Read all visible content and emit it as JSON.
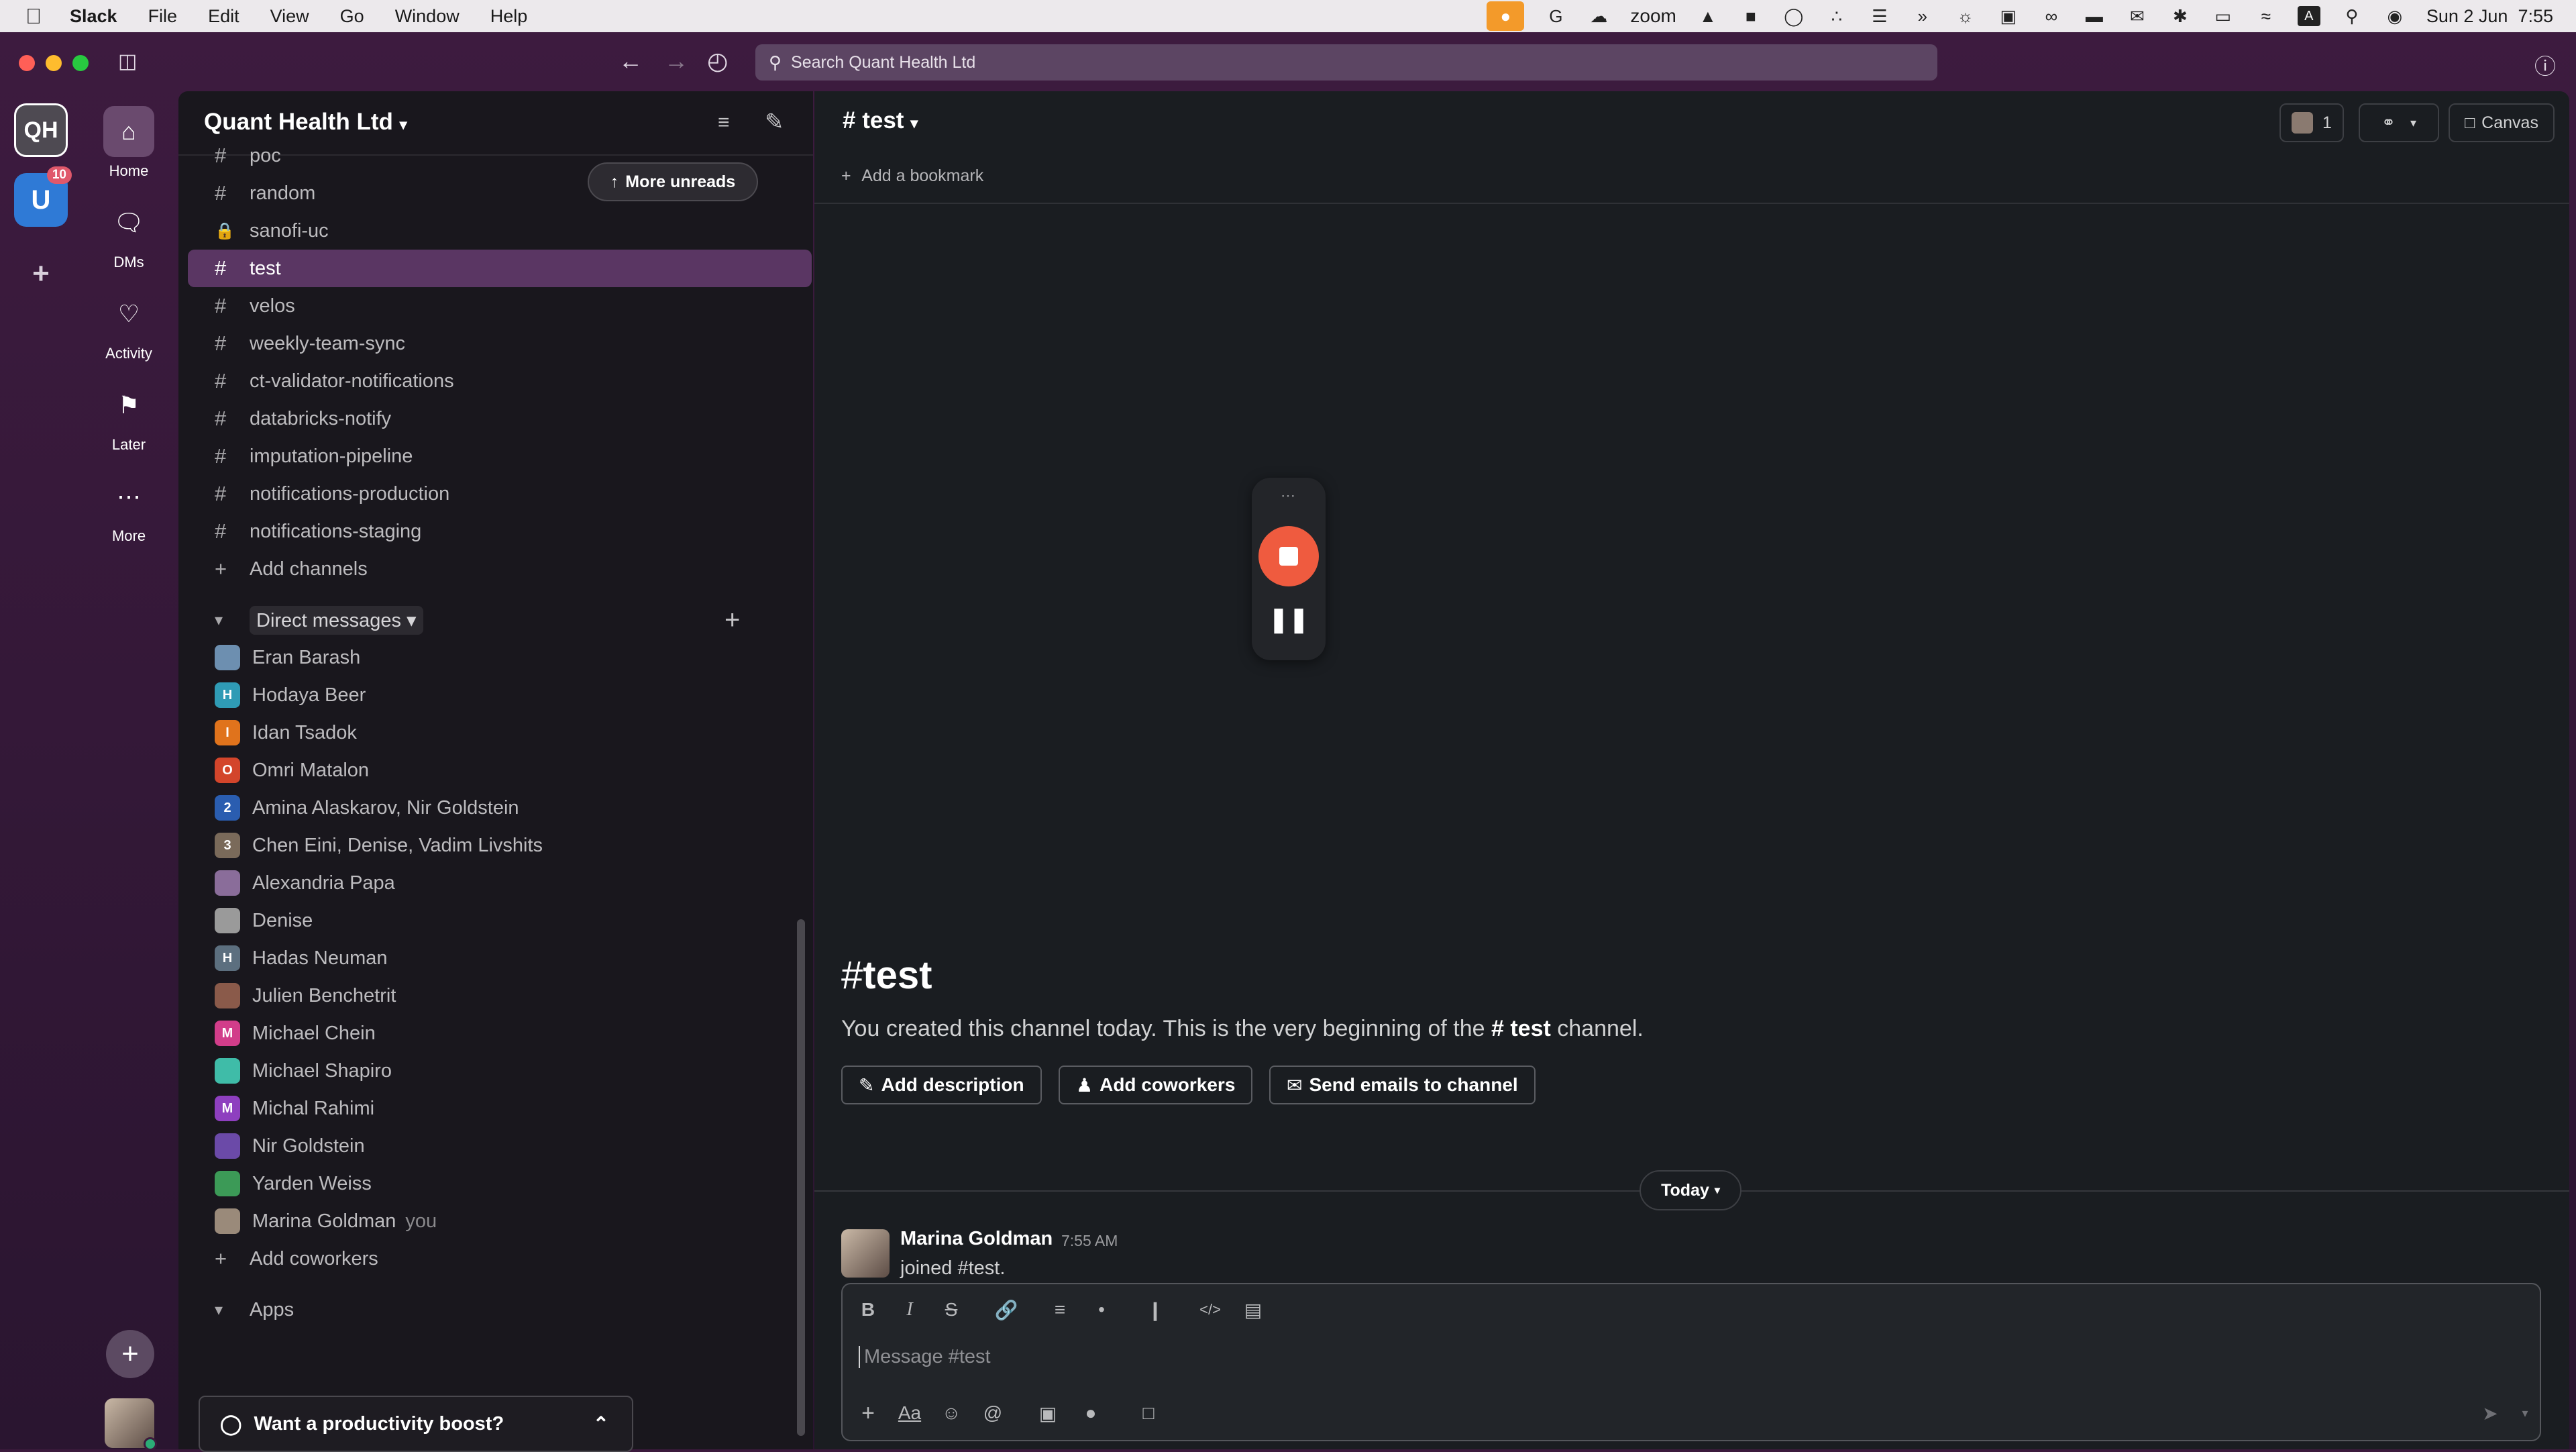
{
  "menubar": {
    "app_name": "Slack",
    "items": [
      "File",
      "Edit",
      "View",
      "Go",
      "Window",
      "Help"
    ],
    "zoom_text": "zoom",
    "datetime": "Sun 2 Jun  7:55"
  },
  "search": {
    "placeholder": "Search Quant Health Ltd"
  },
  "rail": {
    "workspace_initials": "QH",
    "badge_count": "10"
  },
  "nav": {
    "home": "Home",
    "dms": "DMs",
    "activity": "Activity",
    "later": "Later",
    "more": "More"
  },
  "workspace": {
    "name": "Quant Health Ltd"
  },
  "more_unreads": "More unreads",
  "channels": [
    {
      "name": "poc",
      "icon": "#"
    },
    {
      "name": "random",
      "icon": "#"
    },
    {
      "name": "sanofi-uc",
      "icon": "lock"
    },
    {
      "name": "test",
      "icon": "#",
      "active": true
    },
    {
      "name": "velos",
      "icon": "#"
    },
    {
      "name": "weekly-team-sync",
      "icon": "#"
    },
    {
      "name": "ct-validator-notifications",
      "icon": "#"
    },
    {
      "name": "databricks-notify",
      "icon": "#"
    },
    {
      "name": "imputation-pipeline",
      "icon": "#"
    },
    {
      "name": "notifications-production",
      "icon": "#"
    },
    {
      "name": "notifications-staging",
      "icon": "#"
    }
  ],
  "add_channels": "Add channels",
  "dm_section": "Direct messages",
  "dms": [
    {
      "name": "Eran Barash",
      "color": "#6d8fb0",
      "initial": ""
    },
    {
      "name": "Hodaya Beer",
      "color": "#2f9bb5",
      "initial": "H"
    },
    {
      "name": "Idan Tsadok",
      "color": "#e0731c",
      "initial": "I"
    },
    {
      "name": "Omri Matalon",
      "color": "#d3452b",
      "initial": "O"
    },
    {
      "name": "Amina Alaskarov, Nir Goldstein",
      "color": "#2a5db0",
      "initial": "2"
    },
    {
      "name": "Chen Eini, Denise, Vadim Livshits",
      "color": "#7a6a5a",
      "initial": "3"
    },
    {
      "name": "Alexandria Papa",
      "color": "#8a6d9a",
      "initial": ""
    },
    {
      "name": "Denise",
      "color": "#9a9a9a",
      "initial": ""
    },
    {
      "name": "Hadas Neuman",
      "color": "#5c6f7f",
      "initial": "H"
    },
    {
      "name": "Julien Benchetrit",
      "color": "#8a5a4a",
      "initial": ""
    },
    {
      "name": "Michael Chein",
      "color": "#d23d8a",
      "initial": "M"
    },
    {
      "name": "Michael Shapiro",
      "color": "#3fbca8",
      "initial": ""
    },
    {
      "name": "Michal Rahimi",
      "color": "#8e3fbf",
      "initial": "M"
    },
    {
      "name": "Nir Goldstein",
      "color": "#6b4aa8",
      "initial": ""
    },
    {
      "name": "Yarden Weiss",
      "color": "#3c9a57",
      "initial": ""
    },
    {
      "name": "Marina Goldman",
      "color": "#9a8a7a",
      "initial": "",
      "you": "you"
    }
  ],
  "add_coworkers_sidebar": "Add coworkers",
  "apps_section": "Apps",
  "boost": "Want a productivity boost?",
  "channel": {
    "title": "test",
    "add_bookmark": "Add a bookmark",
    "huddle_count": "1",
    "canvas": "Canvas",
    "intro_title": "test",
    "intro_text_pre": "You created this channel today. This is the very beginning of the ",
    "intro_channel": "test",
    "intro_text_post": " channel.",
    "buttons": [
      "Add description",
      "Add coworkers",
      "Send emails to channel"
    ],
    "date_divider": "Today"
  },
  "message": {
    "author": "Marina Goldman",
    "time": "7:55 AM",
    "text": "joined #test."
  },
  "composer": {
    "placeholder": "Message #test"
  },
  "colors": {
    "accent": "#5a3663",
    "rail": "#3b1a3c",
    "sidebar": "#19171d",
    "main": "#1a1d21",
    "record": "#ef5b3f"
  }
}
